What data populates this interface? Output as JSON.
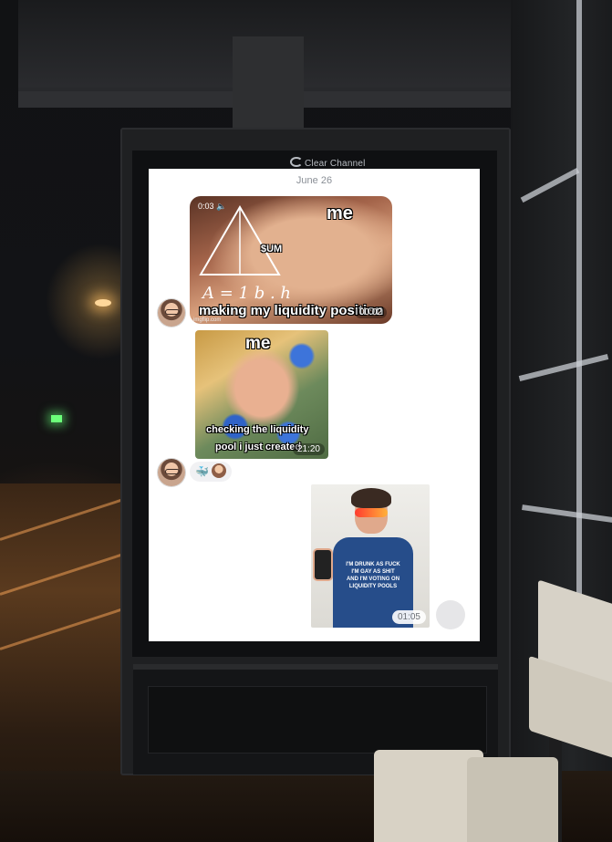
{
  "kiosk": {
    "brand": "Clear Channel"
  },
  "chat": {
    "date": "June 26",
    "messages": [
      {
        "top_text": "me",
        "caption": "making my liquidity position",
        "label": "$UM",
        "formula": "A = 1 b . h",
        "video_time": "0:03",
        "timestamp": "00:02",
        "watermark": "imgflip.com"
      },
      {
        "top_text": "me",
        "caption_line1": "checking the liquidity",
        "caption_line2": "pool i just created",
        "timestamp": "21:20"
      },
      {
        "shirt_lines": [
          "I'M DRUNK AS FUCK",
          "I'M GAY AS SHIT",
          "AND I'M VOTING ON",
          "LIQUIDITY POOLS"
        ],
        "timestamp": "01:05"
      }
    ],
    "reactions": {
      "emoji": "🐳"
    }
  }
}
